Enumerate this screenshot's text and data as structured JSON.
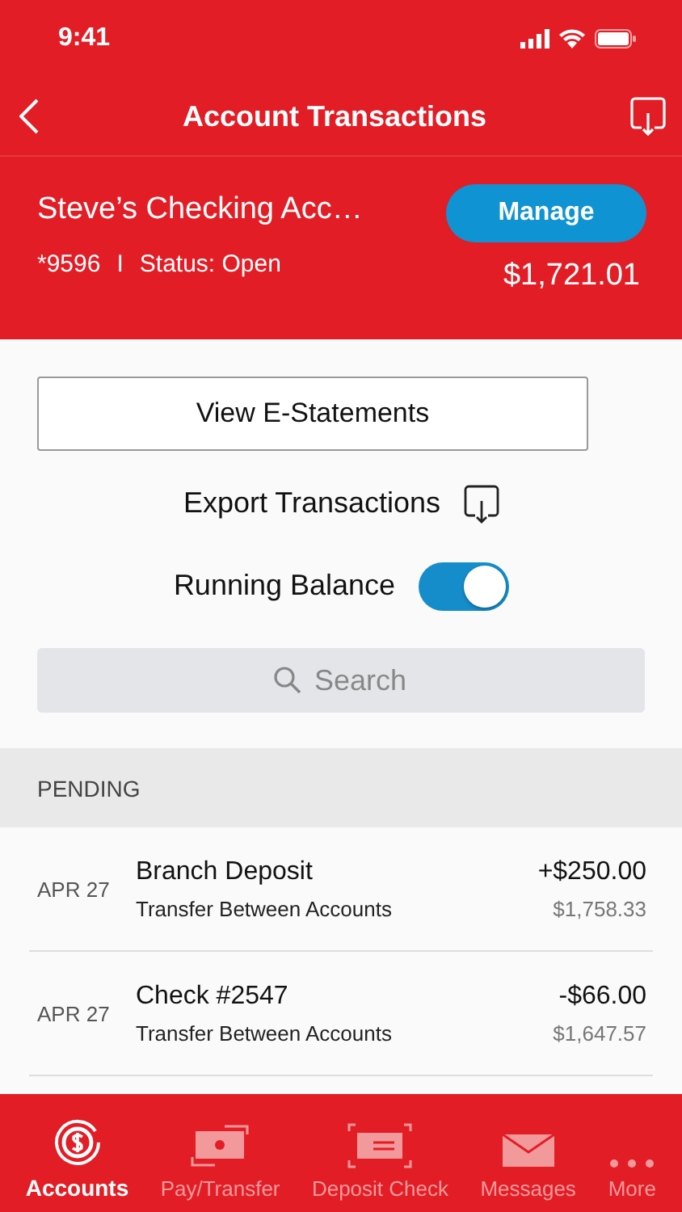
{
  "status_bar": {
    "time": "9:41"
  },
  "nav": {
    "title": "Account Transactions"
  },
  "account": {
    "name": "Steve’s Checking Acc…",
    "number": "*9596",
    "separator": "I",
    "status": "Status: Open",
    "balance": "$1,721.01",
    "manage": "Manage"
  },
  "statements_button": "View E-Statements",
  "export": {
    "label": "Export Transactions"
  },
  "running_balance": {
    "label": "Running Balance",
    "on": true
  },
  "search": {
    "placeholder": "Search"
  },
  "section": "PENDING",
  "transactions": [
    {
      "date": "APR 27",
      "title": "Branch Deposit",
      "subtitle": "Transfer Between Accounts",
      "amount": "+$250.00",
      "balance": "$1,758.33"
    },
    {
      "date": "APR 27",
      "title": "Check #2547",
      "subtitle": "Transfer Between Accounts",
      "amount": "-$66.00",
      "balance": "$1,647.57"
    }
  ],
  "tabs": [
    {
      "kind": "accounts",
      "label": "Accounts",
      "selected": true
    },
    {
      "kind": "pay",
      "label": "Pay/Transfer",
      "selected": false
    },
    {
      "kind": "deposit",
      "label": "Deposit Check",
      "selected": false
    },
    {
      "kind": "messages",
      "label": "Messages",
      "selected": false
    },
    {
      "kind": "more",
      "label": "More",
      "selected": false
    }
  ]
}
